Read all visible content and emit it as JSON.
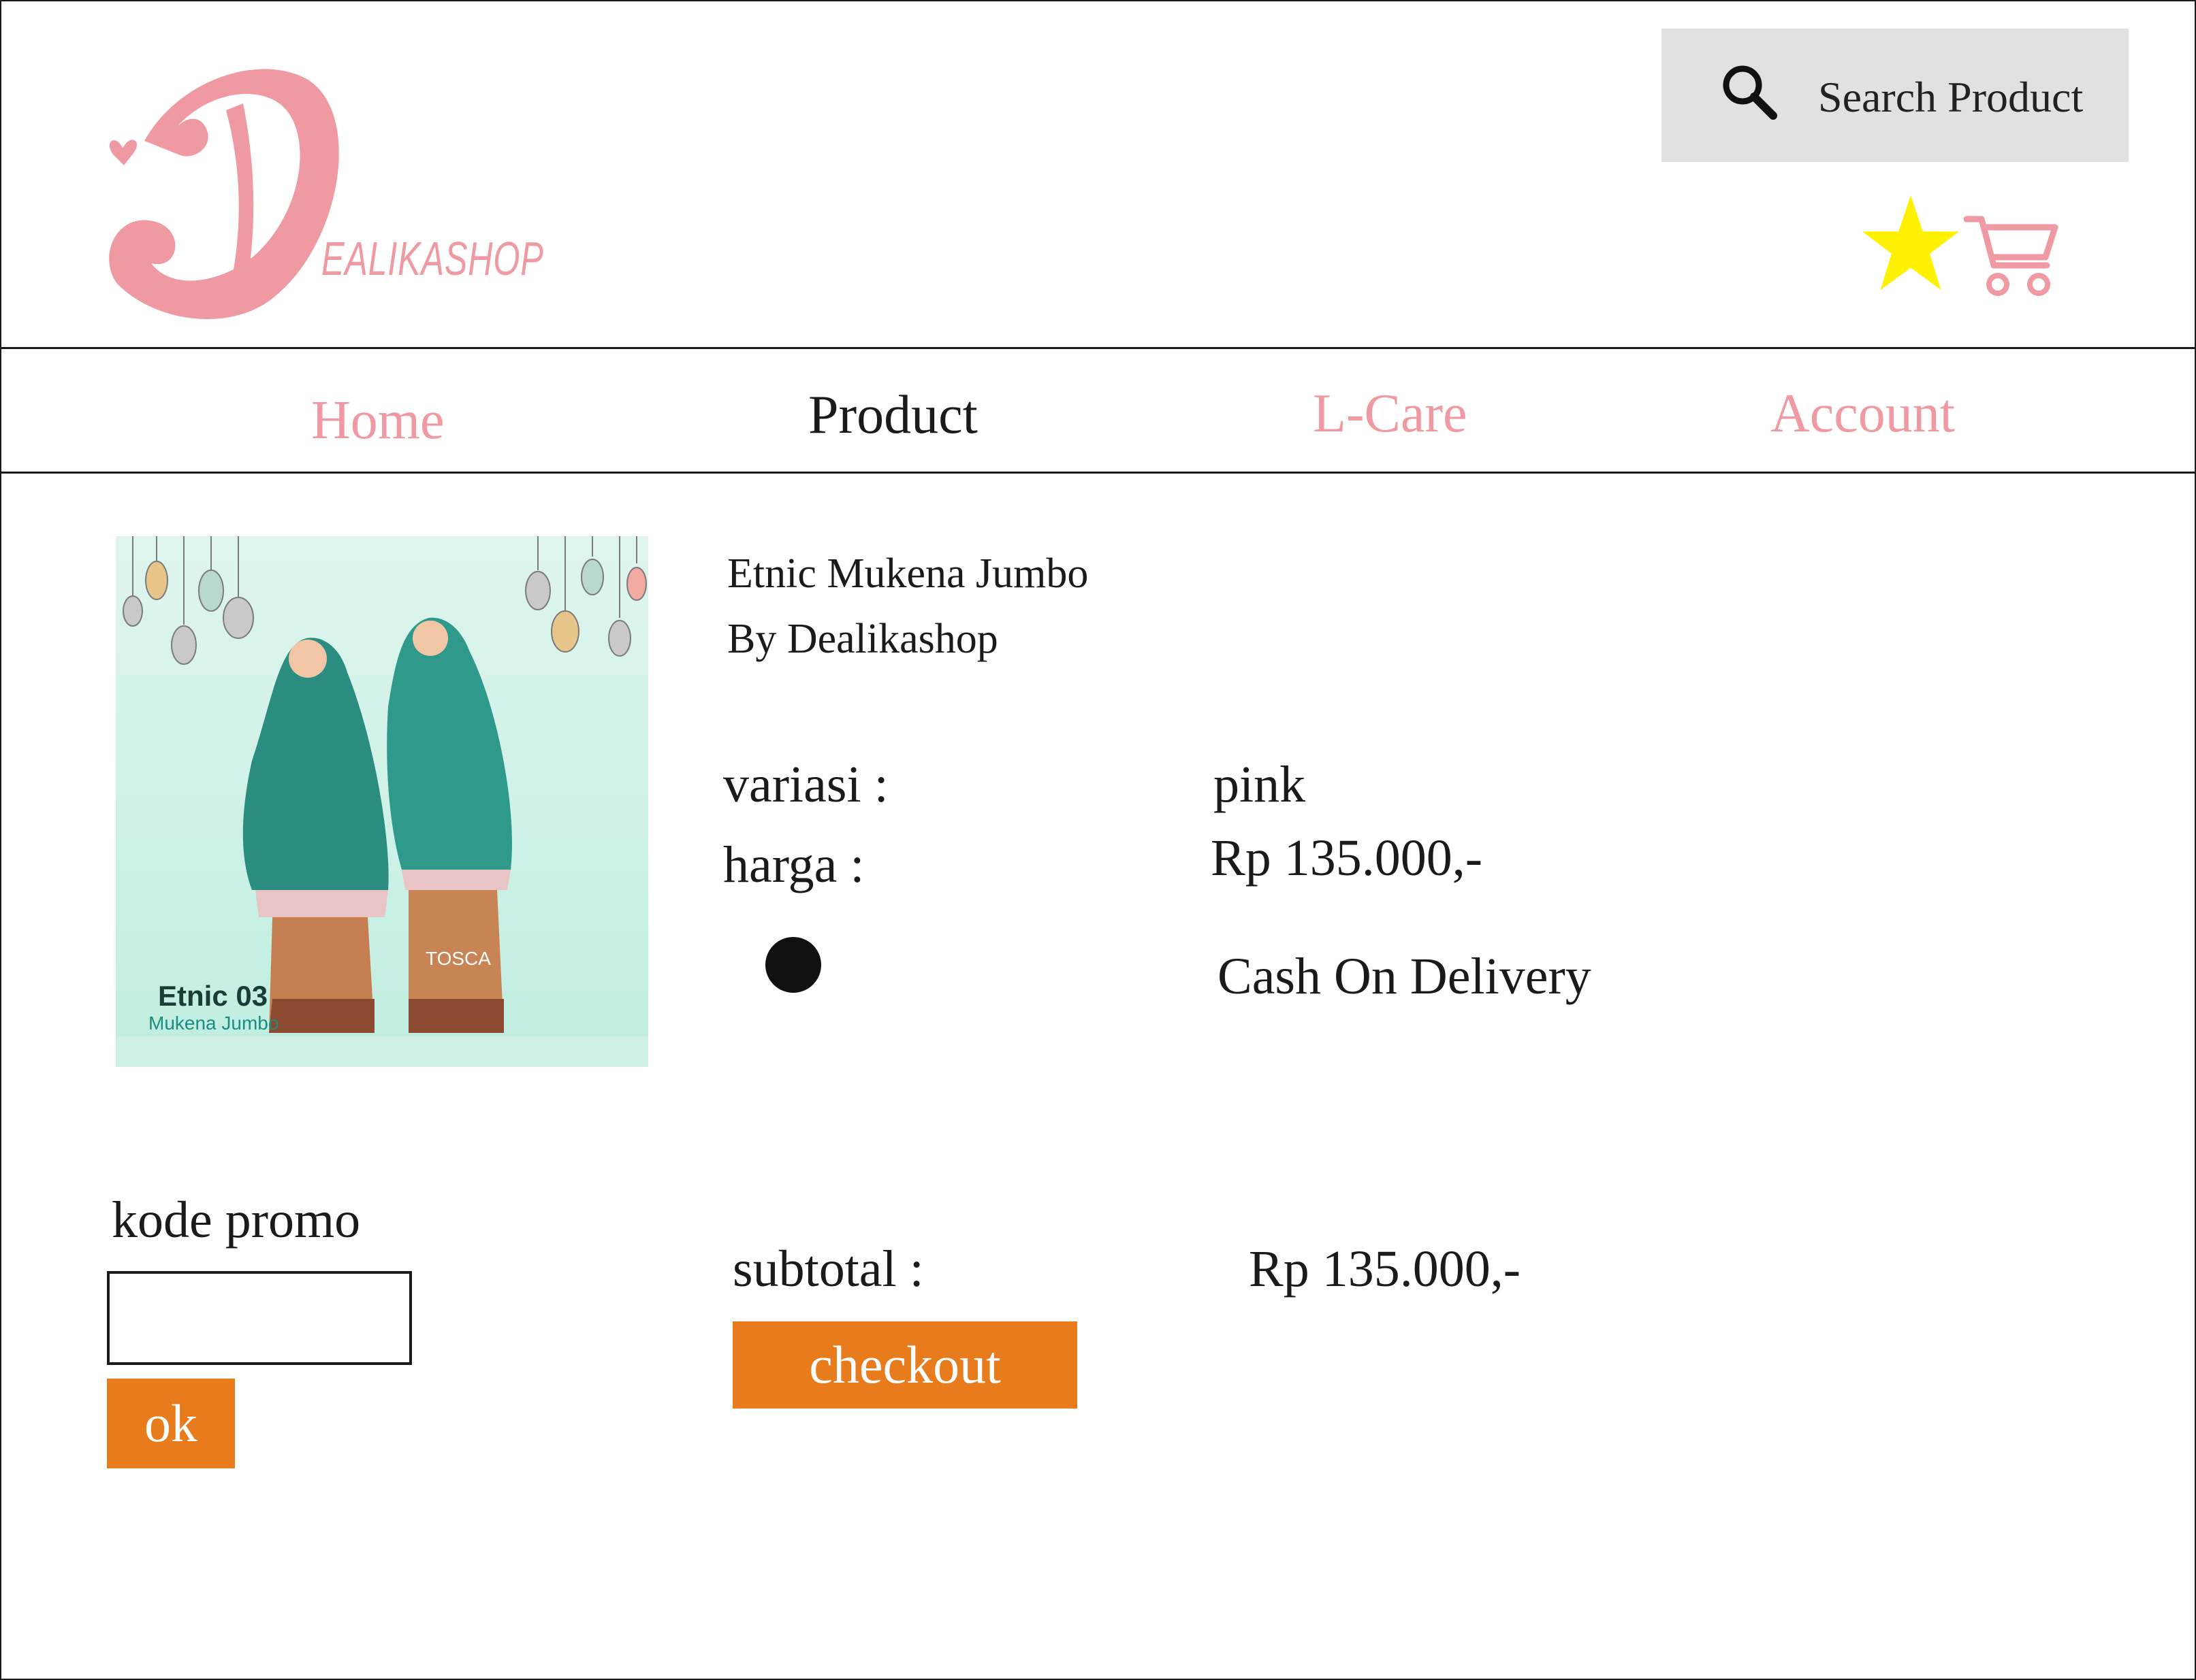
{
  "header": {
    "logo_letter": "D",
    "logo_text": "EALIKASHOP",
    "search_placeholder": "Search Product",
    "brand_color": "#ef9aa2",
    "icons": [
      "search-icon",
      "star-icon",
      "cart-icon"
    ]
  },
  "nav": {
    "items": [
      {
        "label": "Home",
        "active": false
      },
      {
        "label": "Product",
        "active": true
      },
      {
        "label": "L-Care",
        "active": false
      },
      {
        "label": "Account",
        "active": false
      }
    ]
  },
  "product": {
    "image_caption_title": "Etnic 03",
    "image_caption_sub": "Mukena Jumbo",
    "image_color_tag": "TOSCA",
    "name": "Etnic Mukena Jumbo",
    "seller": "By Dealikashop",
    "variasi_label": "variasi :",
    "variasi_value": "pink",
    "harga_label": "harga  :",
    "harga_value": "Rp 135.000,-",
    "payment_method": "Cash On Delivery",
    "payment_selected": true
  },
  "promo": {
    "label": "kode promo",
    "input_value": "",
    "button_label": "ok"
  },
  "checkout": {
    "subtotal_label": "subtotal :",
    "subtotal_value": "Rp 135.000,-",
    "button_label": "checkout",
    "accent_color": "#e87b1c"
  }
}
